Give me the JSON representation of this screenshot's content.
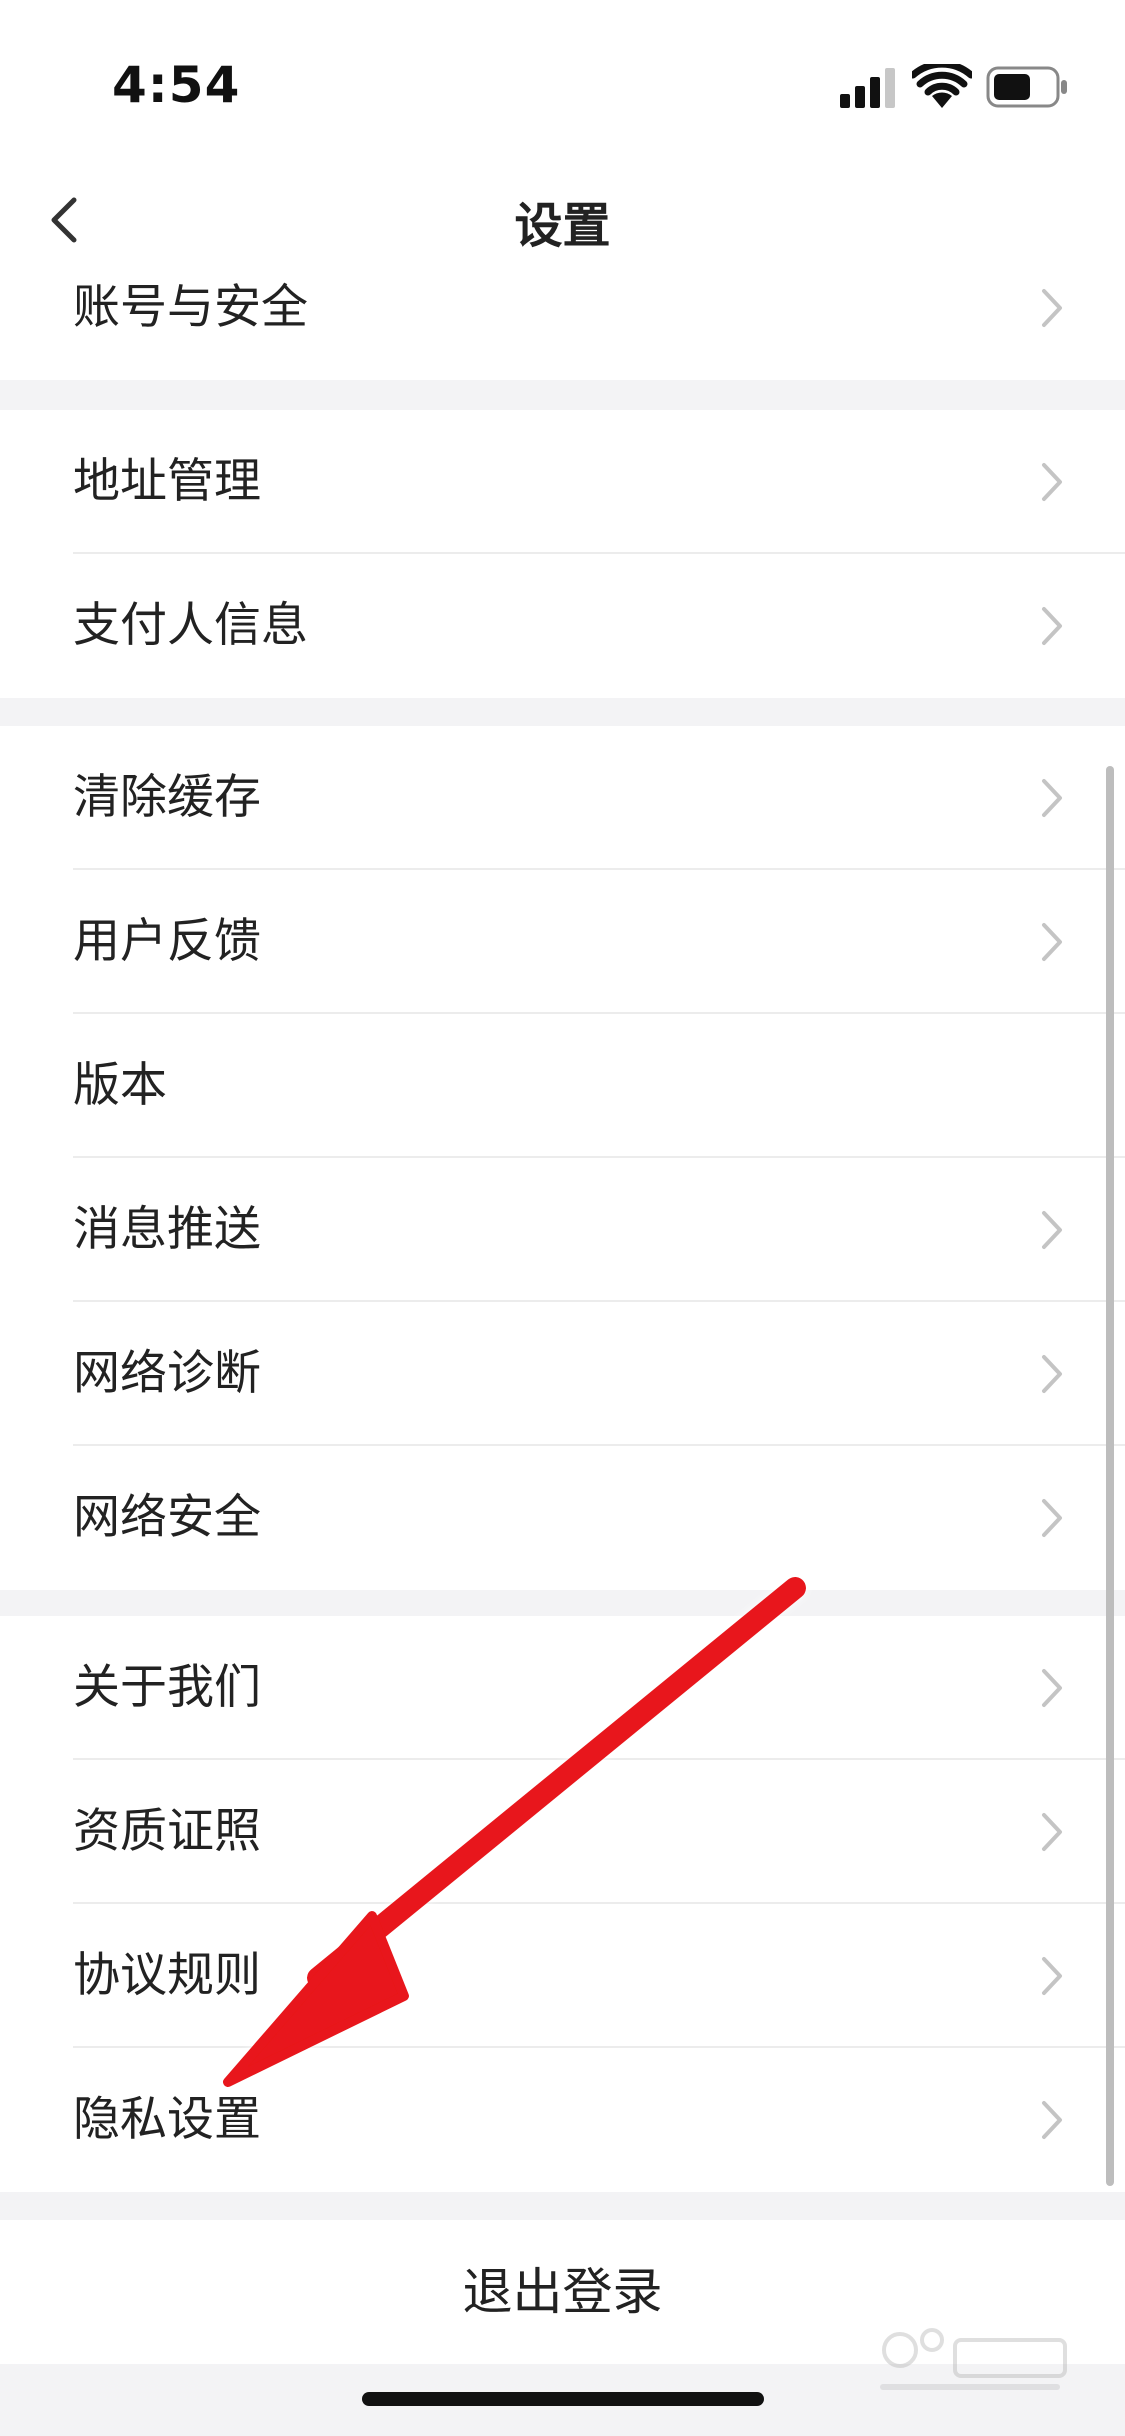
{
  "status_bar": {
    "time": "4:54",
    "icons": [
      "cellular-signal-icon",
      "wifi-icon",
      "battery-icon"
    ]
  },
  "nav": {
    "title": "设置",
    "back_icon": "chevron-left-icon"
  },
  "groups": [
    {
      "items": [
        {
          "label": "账号与安全",
          "has_chevron": true
        }
      ]
    },
    {
      "items": [
        {
          "label": "地址管理",
          "has_chevron": true
        },
        {
          "label": "支付人信息",
          "has_chevron": true
        }
      ]
    },
    {
      "items": [
        {
          "label": "清除缓存",
          "has_chevron": true
        },
        {
          "label": "用户反馈",
          "has_chevron": true
        },
        {
          "label": "版本",
          "has_chevron": false
        },
        {
          "label": "消息推送",
          "has_chevron": true
        },
        {
          "label": "网络诊断",
          "has_chevron": true
        },
        {
          "label": "网络安全",
          "has_chevron": true
        }
      ]
    },
    {
      "items": [
        {
          "label": "关于我们",
          "has_chevron": true
        },
        {
          "label": "资质证照",
          "has_chevron": true
        },
        {
          "label": "协议规则",
          "has_chevron": true
        },
        {
          "label": "隐私设置",
          "has_chevron": true
        }
      ]
    }
  ],
  "logout_label": "退出登录",
  "colors": {
    "background": "#f3f3f5",
    "row_background": "#ffffff",
    "text": "#222222",
    "chevron": "#c4c4c4",
    "annotation_arrow": "#e8161a"
  },
  "annotation": {
    "type": "arrow",
    "points_to": "隐私设置"
  },
  "watermark_icon": "baidu-jingyan-logo"
}
